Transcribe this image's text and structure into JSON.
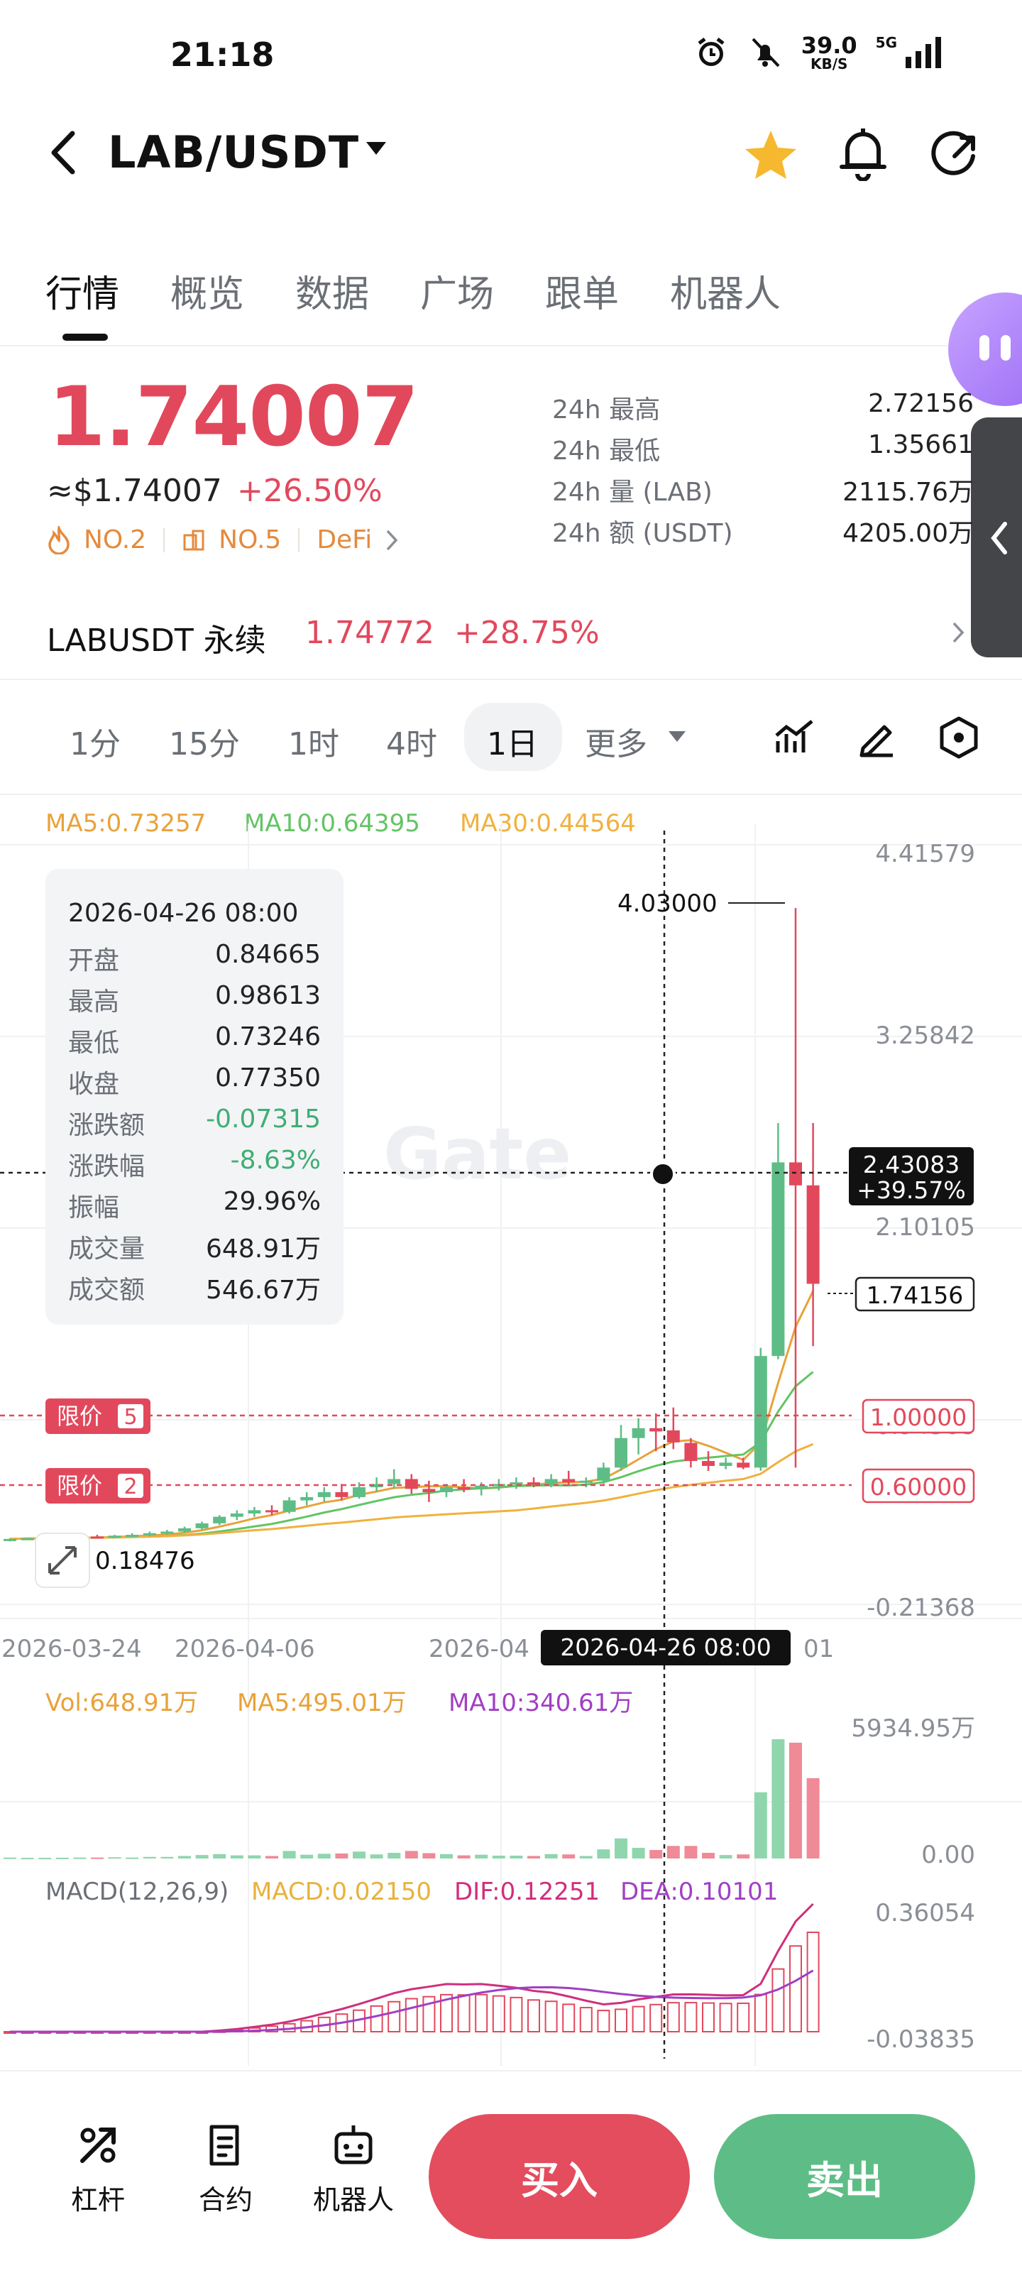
{
  "status_bar": {
    "time": "21:18",
    "net_speed": "39.0",
    "net_unit": "KB/S",
    "signal": "5G"
  },
  "header": {
    "pair": "LAB/USDT"
  },
  "tabs": [
    "行情",
    "概览",
    "数据",
    "广场",
    "跟单",
    "机器人"
  ],
  "price": {
    "last": "1.74007",
    "usd": "≈$1.74007",
    "change": "+26.50%",
    "rank1": "NO.2",
    "rank2": "NO.5",
    "category": "DeFi"
  },
  "stats": [
    {
      "label": "24h  最高",
      "value": "2.72156"
    },
    {
      "label": "24h  最低",
      "value": "1.35661"
    },
    {
      "label": "24h  量 (LAB)",
      "value": "2115.76万"
    },
    {
      "label": "24h  额 (USDT)",
      "value": "4205.00万"
    }
  ],
  "perpetual": {
    "name": "LABUSDT 永续",
    "price": "1.74772",
    "change": "+28.75%"
  },
  "intervals": [
    "1分",
    "15分",
    "1时",
    "4时",
    "1日",
    "更多"
  ],
  "active_interval": "1日",
  "ma_legend": {
    "ma5": "MA5:0.73257",
    "ma10": "MA10:0.64395",
    "ma30": "MA30:0.44564"
  },
  "tooltip": {
    "date": "2026-04-26 08:00",
    "rows": [
      {
        "k": "开盘",
        "v": "0.84665"
      },
      {
        "k": "最高",
        "v": "0.98613"
      },
      {
        "k": "最低",
        "v": "0.73246"
      },
      {
        "k": "收盘",
        "v": "0.77350"
      },
      {
        "k": "涨跌额",
        "v": "-0.07315"
      },
      {
        "k": "涨跌幅",
        "v": "-8.63%"
      },
      {
        "k": "振幅",
        "v": "29.96%"
      },
      {
        "k": "成交量",
        "v": "648.91万"
      },
      {
        "k": "成交额",
        "v": "546.67万"
      }
    ]
  },
  "price_axis": [
    "4.41579",
    "3.25842",
    "2.10105",
    "0.94368",
    "-0.21368"
  ],
  "labels": {
    "high_marker": "4.03000",
    "low_marker": "0.18476",
    "crosshair_price": "2.43083",
    "crosshair_pct": "+39.57%",
    "current_price": "1.74156",
    "crosshair_date": "2026-04-26 08:00",
    "order1_label": "限价",
    "order1_count": "5",
    "order1_price": "1.00000",
    "order2_label": "限价",
    "order2_count": "2",
    "order2_price": "0.60000",
    "watermark": "Gate"
  },
  "date_axis": [
    "2026-03-24",
    "2026-04-06",
    "2026-04",
    "01"
  ],
  "volume": {
    "vol": "Vol:648.91万",
    "ma5": "MA5:495.01万",
    "ma10": "MA10:340.61万",
    "max": "5934.95万",
    "min": "0.00"
  },
  "macd": {
    "title": "MACD(12,26,9)",
    "macd": "MACD:0.02150",
    "dif": "DIF:0.12251",
    "dea": "DEA:0.10101",
    "max": "0.36054",
    "min": "-0.03835"
  },
  "chart_data": {
    "type": "candlestick",
    "ylim": [
      -0.21368,
      4.41579
    ],
    "candles": [
      {
        "o": 0.18,
        "h": 0.19,
        "l": 0.17,
        "c": 0.185
      },
      {
        "o": 0.185,
        "h": 0.19,
        "l": 0.18,
        "c": 0.19
      },
      {
        "o": 0.19,
        "h": 0.2,
        "l": 0.18,
        "c": 0.19
      },
      {
        "o": 0.19,
        "h": 0.2,
        "l": 0.185,
        "c": 0.195
      },
      {
        "o": 0.195,
        "h": 0.21,
        "l": 0.19,
        "c": 0.2
      },
      {
        "o": 0.2,
        "h": 0.21,
        "l": 0.19,
        "c": 0.195
      },
      {
        "o": 0.195,
        "h": 0.21,
        "l": 0.19,
        "c": 0.205
      },
      {
        "o": 0.205,
        "h": 0.22,
        "l": 0.2,
        "c": 0.21
      },
      {
        "o": 0.21,
        "h": 0.23,
        "l": 0.2,
        "c": 0.22
      },
      {
        "o": 0.22,
        "h": 0.24,
        "l": 0.21,
        "c": 0.23
      },
      {
        "o": 0.23,
        "h": 0.26,
        "l": 0.22,
        "c": 0.25
      },
      {
        "o": 0.25,
        "h": 0.29,
        "l": 0.24,
        "c": 0.28
      },
      {
        "o": 0.28,
        "h": 0.33,
        "l": 0.27,
        "c": 0.32
      },
      {
        "o": 0.32,
        "h": 0.36,
        "l": 0.3,
        "c": 0.34
      },
      {
        "o": 0.34,
        "h": 0.38,
        "l": 0.32,
        "c": 0.36
      },
      {
        "o": 0.36,
        "h": 0.39,
        "l": 0.33,
        "c": 0.35
      },
      {
        "o": 0.35,
        "h": 0.44,
        "l": 0.34,
        "c": 0.42
      },
      {
        "o": 0.42,
        "h": 0.47,
        "l": 0.39,
        "c": 0.44
      },
      {
        "o": 0.44,
        "h": 0.5,
        "l": 0.41,
        "c": 0.47
      },
      {
        "o": 0.47,
        "h": 0.52,
        "l": 0.42,
        "c": 0.44
      },
      {
        "o": 0.44,
        "h": 0.53,
        "l": 0.43,
        "c": 0.5
      },
      {
        "o": 0.5,
        "h": 0.56,
        "l": 0.47,
        "c": 0.52
      },
      {
        "o": 0.52,
        "h": 0.61,
        "l": 0.49,
        "c": 0.55
      },
      {
        "o": 0.55,
        "h": 0.58,
        "l": 0.46,
        "c": 0.49
      },
      {
        "o": 0.49,
        "h": 0.54,
        "l": 0.41,
        "c": 0.47
      },
      {
        "o": 0.47,
        "h": 0.52,
        "l": 0.44,
        "c": 0.5
      },
      {
        "o": 0.5,
        "h": 0.55,
        "l": 0.47,
        "c": 0.49
      },
      {
        "o": 0.49,
        "h": 0.53,
        "l": 0.45,
        "c": 0.51
      },
      {
        "o": 0.51,
        "h": 0.55,
        "l": 0.48,
        "c": 0.52
      },
      {
        "o": 0.52,
        "h": 0.56,
        "l": 0.49,
        "c": 0.53
      },
      {
        "o": 0.53,
        "h": 0.56,
        "l": 0.5,
        "c": 0.52
      },
      {
        "o": 0.52,
        "h": 0.58,
        "l": 0.5,
        "c": 0.55
      },
      {
        "o": 0.55,
        "h": 0.6,
        "l": 0.51,
        "c": 0.53
      },
      {
        "o": 0.53,
        "h": 0.56,
        "l": 0.5,
        "c": 0.54
      },
      {
        "o": 0.54,
        "h": 0.65,
        "l": 0.52,
        "c": 0.62
      },
      {
        "o": 0.62,
        "h": 0.88,
        "l": 0.6,
        "c": 0.8
      },
      {
        "o": 0.8,
        "h": 0.92,
        "l": 0.7,
        "c": 0.86
      },
      {
        "o": 0.86,
        "h": 0.95,
        "l": 0.72,
        "c": 0.84
      },
      {
        "o": 0.84665,
        "h": 0.98613,
        "l": 0.73246,
        "c": 0.7735
      },
      {
        "o": 0.77,
        "h": 0.8,
        "l": 0.62,
        "c": 0.66
      },
      {
        "o": 0.66,
        "h": 0.72,
        "l": 0.6,
        "c": 0.63
      },
      {
        "o": 0.63,
        "h": 0.68,
        "l": 0.61,
        "c": 0.65
      },
      {
        "o": 0.65,
        "h": 0.68,
        "l": 0.61,
        "c": 0.62
      },
      {
        "o": 0.62,
        "h": 1.35,
        "l": 0.6,
        "c": 1.3
      },
      {
        "o": 1.3,
        "h": 2.72,
        "l": 1.28,
        "c": 2.48
      },
      {
        "o": 2.48,
        "h": 4.03,
        "l": 0.62,
        "c": 2.34
      },
      {
        "o": 2.34,
        "h": 2.72,
        "l": 1.36,
        "c": 1.74
      }
    ]
  }
}
